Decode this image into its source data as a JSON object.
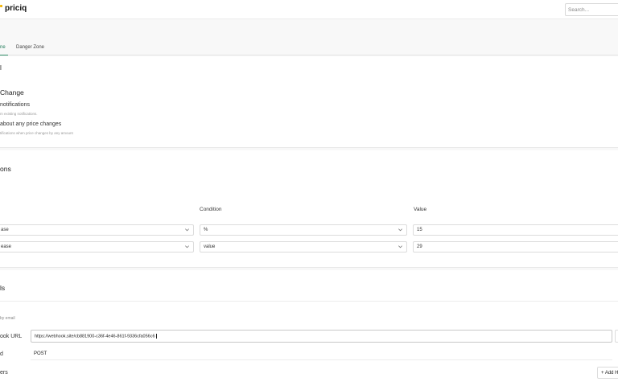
{
  "app": {
    "name": "priciq",
    "brand_color": "#f2b400",
    "accent_color": "#2e8a66"
  },
  "search": {
    "placeholder": "Search..."
  },
  "tabs": [
    {
      "label": "ne",
      "active": true
    },
    {
      "label": "Danger Zone",
      "active": false
    }
  ],
  "notifications": {
    "section_marker": "l",
    "title": "Change",
    "options": [
      {
        "label": "notifications",
        "description": "m existing notifications."
      },
      {
        "label": "about any price changes",
        "description": "tifications when price changes by any amount"
      }
    ]
  },
  "conditions": {
    "title": "ons",
    "headers": {
      "condition": "Condition",
      "value": "Value"
    },
    "rows": [
      {
        "field": "ase",
        "condition": "%",
        "value": "15"
      },
      {
        "field": "ease",
        "condition": "value",
        "value": "29"
      }
    ]
  },
  "channels": {
    "title": "ls",
    "email_label": "by email",
    "webhook_url_label": "ook URL",
    "webhook_url_value": "https://webhook.site/cb881900-c36f-4e46-861f-9336cfa056c6",
    "method_label": "d",
    "method_value": "POST",
    "headers_label": "ers",
    "add_button_label": "+ Add H"
  },
  "icons": {
    "chevron": "chevron-down-icon"
  }
}
